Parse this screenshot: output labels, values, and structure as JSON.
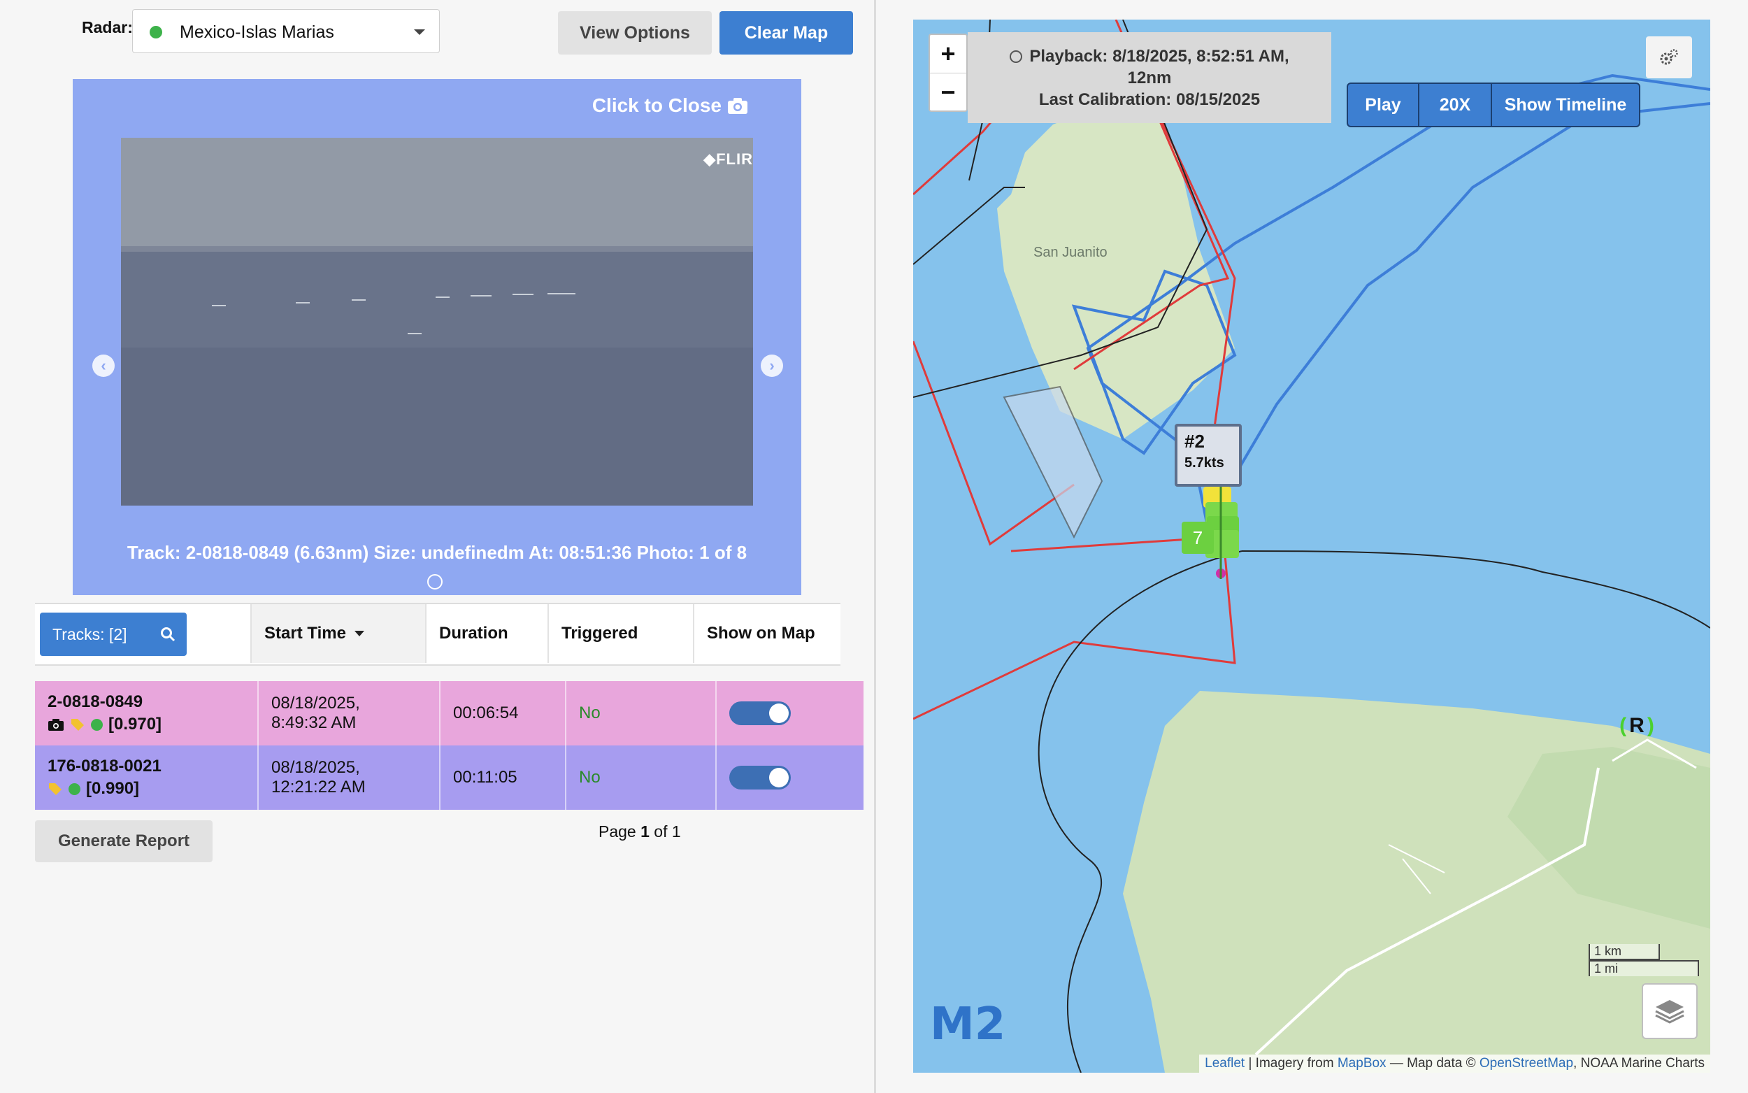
{
  "radar": {
    "label": "Radar:",
    "value": "Mexico-Islas Marias"
  },
  "toolbar": {
    "view_options": "View Options",
    "clear_map": "Clear Map"
  },
  "viewer": {
    "close_label": "Click to Close",
    "brand": "FLIR",
    "caption": "Track: 2-0818-0849 (6.63nm) Size: undefinedm At: 08:51:36 Photo: 1 of 8"
  },
  "tracks": {
    "button_label": "Tracks: [2]",
    "columns": [
      "Start Time",
      "Duration",
      "Triggered",
      "Show on Map"
    ],
    "rows": [
      {
        "id": "2-0818-0849",
        "score": "[0.970]",
        "start_date": "08/18/2025,",
        "start_time": "8:49:32 AM",
        "duration": "00:06:54",
        "triggered": "No",
        "color": "#e8a6dc"
      },
      {
        "id": "176-0818-0021",
        "score": "[0.990]",
        "start_date": "08/18/2025,",
        "start_time": "12:21:22 AM",
        "duration": "00:11:05",
        "triggered": "No",
        "color": "#a79cf0"
      }
    ]
  },
  "report": {
    "label": "Generate Report"
  },
  "pager": {
    "prefix": "Page",
    "current": "1",
    "middle": "of",
    "total": "1"
  },
  "map": {
    "zoom_in": "+",
    "zoom_out": "−",
    "playback_line1": "Playback: 8/18/2025, 8:52:51 AM,",
    "playback_line2": "12nm",
    "calibration": "Last Calibration: 08/15/2025",
    "play": "Play",
    "speed": "20X",
    "timeline": "Show Timeline",
    "place_label": "San Juanito",
    "track_tag_id": "#2",
    "track_tag_speed": "5.7kts",
    "track_marker_label": "7",
    "radar_marker": "R",
    "scale_km": "1 km",
    "scale_mi": "1 mi",
    "logo": "M2",
    "attribution": {
      "leaflet": "Leaflet",
      "sep1": " | Imagery from ",
      "mapbox": "MapBox",
      "sep2": " — Map data © ",
      "osm": "OpenStreetMap",
      "tail": ", NOAA Marine Charts"
    }
  }
}
